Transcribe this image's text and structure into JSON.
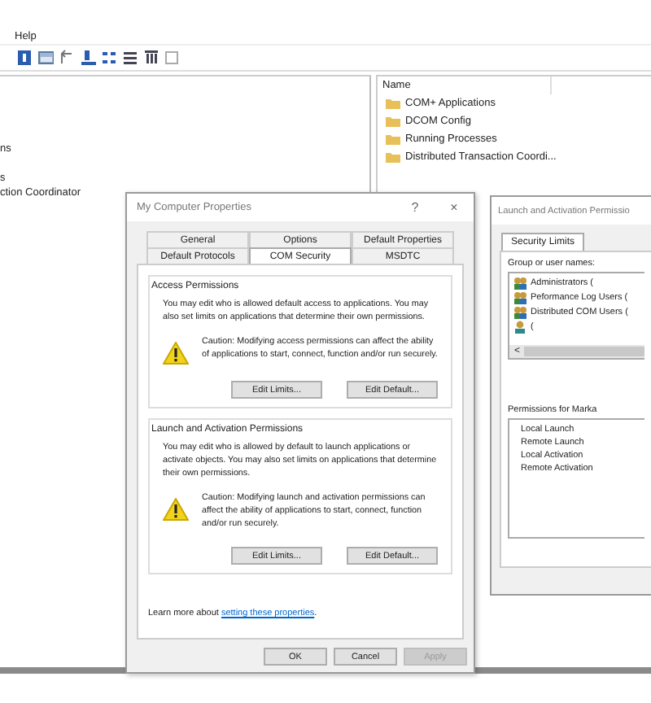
{
  "menu": [
    {
      "label": "Help"
    }
  ],
  "tree": {
    "items": [
      "ns",
      "s",
      "ction Coordinator"
    ]
  },
  "list": {
    "header": "Name",
    "items": [
      "COM+ Applications",
      "DCOM Config",
      "Running Processes",
      "Distributed Transaction Coordi..."
    ]
  },
  "dialog": {
    "title": "My Computer Properties",
    "help": "?",
    "close": "×",
    "tab_rows": [
      [
        {
          "label": "General",
          "selected": false
        },
        {
          "label": "Options",
          "selected": false
        },
        {
          "label": "Default Properties",
          "selected": false
        }
      ],
      [
        {
          "label": "Default Protocols",
          "selected": false
        },
        {
          "label": "COM Security",
          "selected": true
        },
        {
          "label": "MSDTC",
          "selected": false
        }
      ]
    ],
    "groups": [
      {
        "title": "Access Permissions",
        "text": "You may edit who is allowed default access to applications. You may also set limits on applications that determine their own permissions.",
        "caution": "Caution: Modifying access permissions can affect the ability of applications to start, connect, function and/or run securely.",
        "buttons": [
          "Edit Limits...",
          "Edit Default..."
        ]
      },
      {
        "title": "Launch and Activation Permissions",
        "text": "You may edit who is allowed by default to launch applications or activate objects. You may also set limits on applications that determine their own permissions.",
        "caution": "Caution: Modifying launch and activation permissions can affect the ability of applications to start, connect, function and/or run securely.",
        "buttons": [
          "Edit Limits...",
          "Edit Default..."
        ]
      }
    ],
    "learn_more": {
      "text": "Learn more about ",
      "link": "setting these properties",
      "end": "."
    },
    "buttons": [
      {
        "label": "OK",
        "disabled": false
      },
      {
        "label": "Cancel",
        "disabled": false
      },
      {
        "label": "Apply",
        "disabled": true
      }
    ]
  },
  "launch_dialog": {
    "title": "Launch and Activation Permissio",
    "tabs": [
      {
        "label": "Security Limits",
        "selected": true
      }
    ],
    "group_label": "Group or user names:",
    "users": [
      {
        "name": "Administrators (",
        "kind": "group"
      },
      {
        "name": "Peformance Log Users (",
        "kind": "group"
      },
      {
        "name": "Distributed COM Users (",
        "kind": "group"
      },
      {
        "name": "(",
        "kind": "user"
      }
    ],
    "scroll_left": "<",
    "permissions_label": "Permissions for Marka",
    "permissions": [
      "Local Launch",
      "Remote Launch",
      "Local Activation",
      "Remote Activation"
    ]
  }
}
